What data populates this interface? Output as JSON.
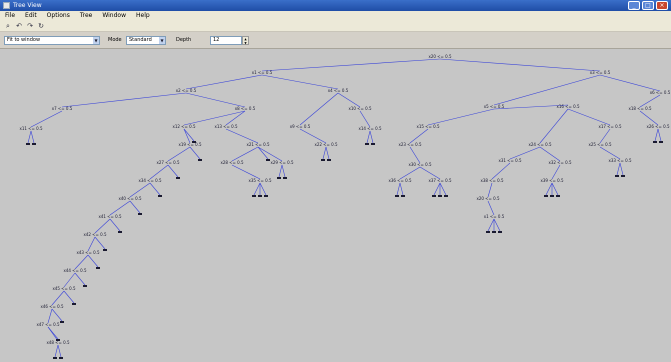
{
  "window": {
    "title": "Tree View",
    "buttons": [
      "_",
      "□",
      "×"
    ]
  },
  "menu": [
    "File",
    "Edit",
    "Options",
    "Tree",
    "Window",
    "Help"
  ],
  "toolbar": {
    "icons": [
      "zoom-icon",
      "undo-icon",
      "redo-icon",
      "refresh-icon"
    ]
  },
  "options": {
    "tree_select": "Fit to window",
    "mode_label": "Mode",
    "mode_value": "Standard",
    "depth_label": "Depth",
    "depth_value": "12"
  },
  "colors": {
    "edge": "#3c46d8",
    "canvas": "#c6c6c6",
    "titlebar": "#1f4da6"
  },
  "tree": {
    "root": "x20 <= 0.5",
    "labels": [
      "x20 <= 0.5",
      "x1 <= 0.5",
      "x3 <= 0.5",
      "x2 <= 0.5",
      "x4 <= 0.5",
      "x5 <= 0.5",
      "x6 <= 0.5",
      "x7 <= 0.5",
      "x8 <= 0.5",
      "x9 <= 0.5",
      "x10 <= 0.5",
      "x11 <= 0.5",
      "x12 <= 0.5",
      "x13 <= 0.5",
      "x14 <= 0.5",
      "x15 <= 0.5",
      "x16 <= 0.5",
      "x17 <= 0.5",
      "x18 <= 0.5",
      "x19 <= 0.5",
      "x21 <= 0.5",
      "x22 <= 0.5",
      "x23 <= 0.5",
      "x24 <= 0.5",
      "x25 <= 0.5",
      "x26 <= 0.5",
      "x27 <= 0.5",
      "x28 <= 0.5",
      "x29 <= 0.5",
      "x30 <= 0.5",
      "x31 <= 0.5",
      "x32 <= 0.5",
      "x33 <= 0.5",
      "x34 <= 0.5",
      "x35 <= 0.5",
      "x36 <= 0.5",
      "x37 <= 0.5",
      "x38 <= 0.5",
      "x39 <= 0.5",
      "x40 <= 0.5",
      "x41 <= 0.5",
      "x42 <= 0.5",
      "x43 <= 0.5",
      "x44 <= 0.5",
      "x45 <= 0.5",
      "x46 <= 0.5",
      "x47 <= 0.5",
      "x48 <= 0.5"
    ]
  }
}
